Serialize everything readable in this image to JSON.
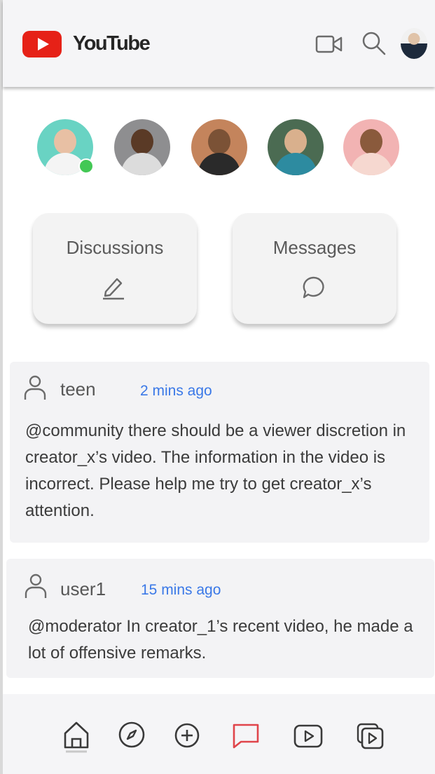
{
  "app": {
    "brand": "YouTube"
  },
  "cards": {
    "discussions_label": "Discussions",
    "messages_label": "Messages"
  },
  "posts": [
    {
      "user": "teen",
      "time": "2 mins ago",
      "text": "@community there should be a viewer discretion in creator_x’s video. The information in the video is incorrect. Please help me try to get creator_x’s attention."
    },
    {
      "user": "user1",
      "time": "15 mins ago",
      "text": "@moderator In creator_1’s recent video, he made a lot of offensive remarks."
    }
  ],
  "nav": {
    "active": "chat"
  },
  "colors": {
    "accent_red": "#e62117",
    "link_blue": "#3a78e7",
    "online_green": "#43c855",
    "active_nav": "#e0454b"
  }
}
